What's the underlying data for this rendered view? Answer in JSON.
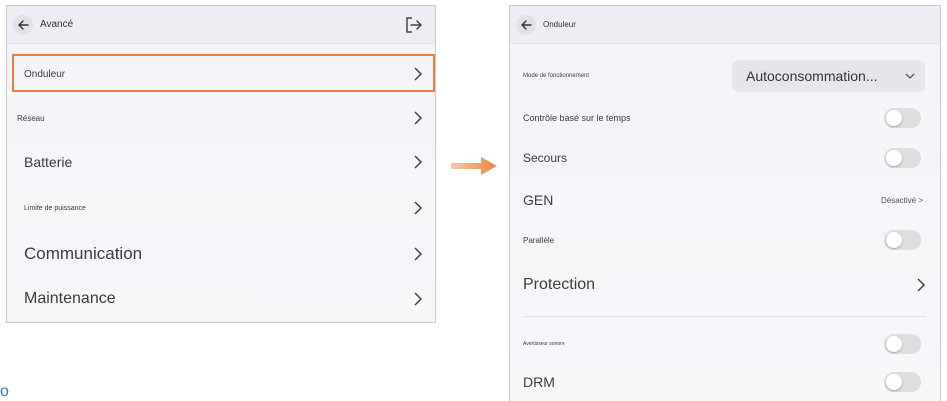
{
  "left_panel": {
    "title": "Avancé",
    "items": [
      {
        "label": "Onduleur"
      },
      {
        "label": "Réseau"
      },
      {
        "label": "Batterie"
      },
      {
        "label": "Limite de puissance"
      },
      {
        "label": "Communication"
      },
      {
        "label": "Maintenance"
      }
    ]
  },
  "right_panel": {
    "title": "Onduleur",
    "mode_label": "Mode de fonctionnement",
    "mode_value": "Autoconsommation...",
    "time_control_label": "Contrôle basé sur le temps",
    "backup_label": "Secours",
    "gen_label": "GEN",
    "gen_value": "Désactivé >",
    "parallel_label": "Parallèle",
    "protection_label": "Protection",
    "buzzer_label": "Avertisseur sonore",
    "drm_label": "DRM"
  },
  "stray_text": "o",
  "colors": {
    "highlight": "#e87f3a",
    "arrow": "#e8893f",
    "toggle_off": "#dedede"
  }
}
